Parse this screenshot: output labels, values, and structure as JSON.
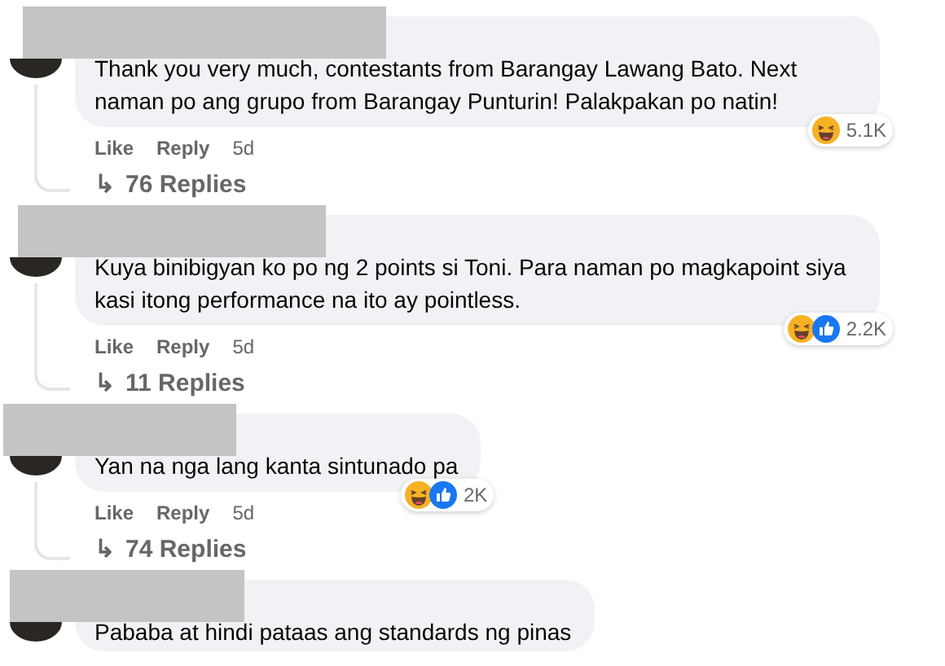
{
  "comments": [
    {
      "text": "Thank you very much, contestants from Barangay Lawang Bato. Next naman po ang grupo from Barangay Punturin! Palakpakan po natin!",
      "reactions": {
        "icons": [
          {
            "kind": "haha"
          }
        ],
        "count": "5.1K"
      },
      "actions": {
        "like": "Like",
        "reply": "Reply",
        "time": "5d"
      },
      "replies": {
        "arrow": "↳",
        "label": "76 Replies"
      }
    },
    {
      "text": "Kuya binibigyan ko po ng 2 points si Toni. Para naman po magkapoint siya kasi itong performance na ito ay pointless.",
      "reactions": {
        "icons": [
          {
            "kind": "haha"
          },
          {
            "kind": "like"
          }
        ],
        "count": "2.2K"
      },
      "actions": {
        "like": "Like",
        "reply": "Reply",
        "time": "5d"
      },
      "replies": {
        "arrow": "↳",
        "label": "11 Replies"
      }
    },
    {
      "text": "Yan na nga lang kanta sintunado pa",
      "reactions": {
        "icons": [
          {
            "kind": "haha"
          },
          {
            "kind": "like"
          }
        ],
        "count": "2K"
      },
      "actions": {
        "like": "Like",
        "reply": "Reply",
        "time": "5d"
      },
      "replies": {
        "arrow": "↳",
        "label": "74 Replies"
      }
    },
    {
      "text": "Pababa at hindi pataas ang standards ng pinas"
    }
  ]
}
